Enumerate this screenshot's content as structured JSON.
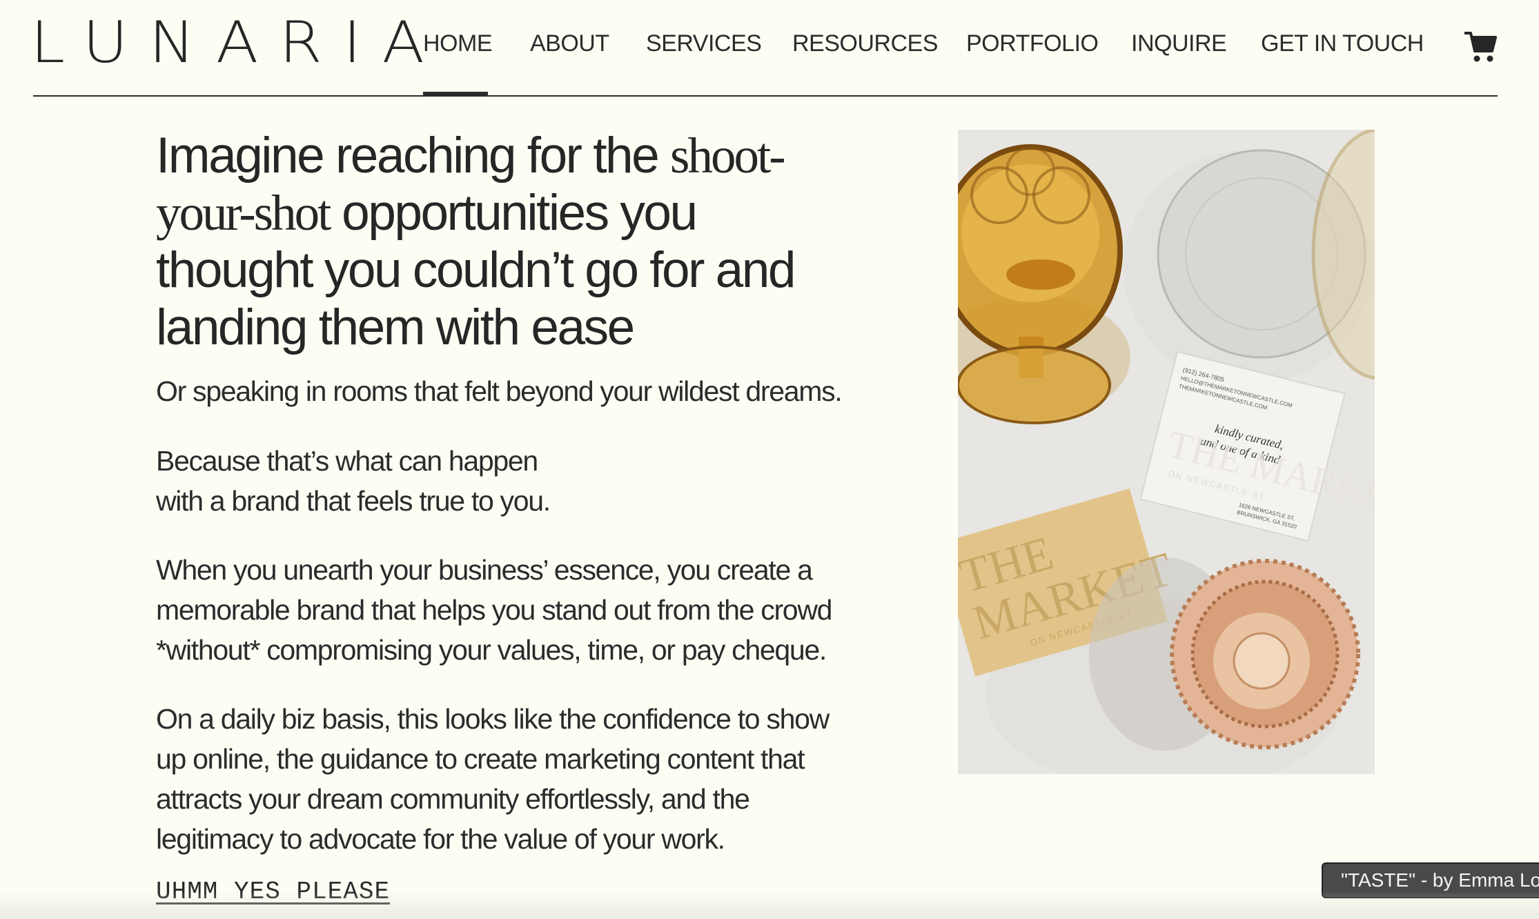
{
  "brand": {
    "logo": "LUNARIA"
  },
  "nav": {
    "items": [
      {
        "label": "HOME",
        "active": true
      },
      {
        "label": "ABOUT"
      },
      {
        "label": "SERVICES"
      },
      {
        "label": "RESOURCES"
      },
      {
        "label": "PORTFOLIO"
      },
      {
        "label": "INQUIRE"
      },
      {
        "label": "GET IN TOUCH"
      }
    ],
    "cart_icon": "shopping-cart-icon"
  },
  "hero": {
    "headline": {
      "part1": "Imagine reaching for the ",
      "accent": "shoot-your-shot",
      "part2": " opportunities you thought you couldn’t go for and landing them with ease"
    },
    "paragraphs": [
      "Or speaking in rooms that felt beyond your wildest dreams.",
      "Because that’s what can happen with a brand that feels true to you.",
      "When you unearth your business’ essence, you create a memorable brand that helps you stand out from the crowd *without* compromising your values, time, or pay cheque.",
      "On a daily biz basis, this looks like the confidence to show up online, the guidance to create marketing content that attracts your dream community effortlessly, and the legitimacy to advocate for the value of your work."
    ],
    "cta": "UHMM YES PLEASE"
  },
  "image": {
    "card_back": {
      "phone": "(912) 264-7805",
      "email": "HELLO@THEMARKETONNEWCASTLE.COM",
      "web": "THEMARKETONNEWCASTLE.COM",
      "tagline_1": "kindly curated,",
      "tagline_2": "and one of a kind",
      "address_1": "1626 NEWCASTLE ST,",
      "address_2": "BRUNSWICK, GA 31520",
      "watermark": "THE MARKET",
      "watermark_sub": "ON NEWCASTLE ST"
    },
    "card_front": {
      "line1": "THE",
      "line2": "MARKET",
      "sub": "ON NEWCASTLE ST"
    }
  },
  "music_badge": "\"TASTE\" - by Emma Lo",
  "colors": {
    "background": "#fdfdf4",
    "text": "#2b2b2b",
    "amber_glass": "#d49a2a",
    "gold_card": "#e2c48a",
    "stone": "#e6e5e2"
  }
}
